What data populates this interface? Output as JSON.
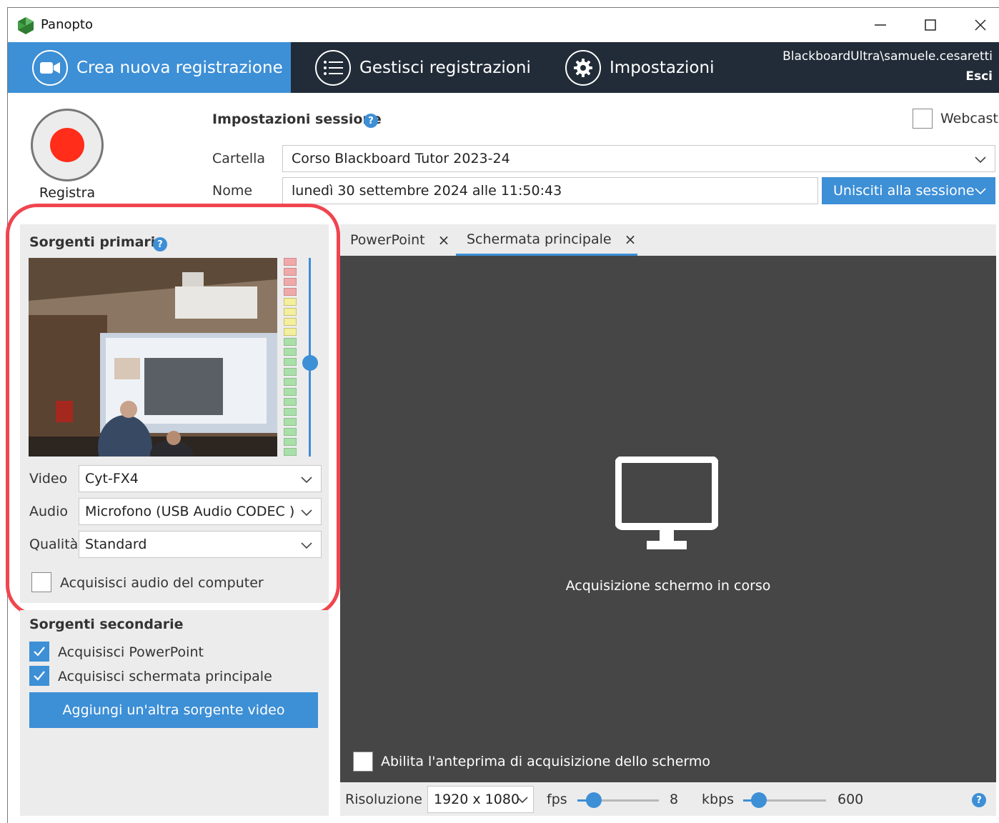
{
  "window": {
    "title": "Panopto"
  },
  "nav": {
    "tabs": [
      {
        "label": "Crea nuova registrazione",
        "icon": "video-camera-icon"
      },
      {
        "label": "Gestisci registrazioni",
        "icon": "list-icon"
      },
      {
        "label": "Impostazioni",
        "icon": "gear-icon"
      }
    ],
    "user": "BlackboardUltra\\samuele.cesaretti",
    "logout": "Esci"
  },
  "record": {
    "label": "Registra"
  },
  "session": {
    "title": "Impostazioni sessione",
    "webcast_label": "Webcast",
    "webcast_checked": false,
    "folder_label": "Cartella",
    "folder_value": "Corso Blackboard Tutor 2023-24",
    "name_label": "Nome",
    "name_value": "lunedì 30 settembre 2024 alle 11:50:43",
    "join_label": "Unisciti alla sessione"
  },
  "primary": {
    "title": "Sorgenti primarie",
    "video_label": "Video",
    "video_value": "Cyt-FX4",
    "audio_label": "Audio",
    "audio_value": "Microfono (USB Audio CODEC )",
    "quality_label": "Qualità",
    "quality_value": "Standard",
    "computer_audio_label": "Acquisisci audio del computer",
    "computer_audio_checked": false,
    "volume_level": 0.47
  },
  "secondary": {
    "title": "Sorgenti secondarie",
    "items": [
      {
        "label": "Acquisisci PowerPoint",
        "checked": true
      },
      {
        "label": "Acquisisci schermata principale",
        "checked": true
      }
    ],
    "add_label": "Aggiungi un'altra sorgente video"
  },
  "preview": {
    "tabs": [
      {
        "label": "PowerPoint",
        "active": false
      },
      {
        "label": "Schermata principale",
        "active": true
      }
    ],
    "status": "Acquisizione schermo in corso",
    "enable_preview_label": "Abilita l'anteprima di acquisizione dello schermo",
    "enable_preview_checked": false
  },
  "capture_settings": {
    "resolution_label": "Risoluzione",
    "resolution_value": "1920 x 1080",
    "fps_label": "fps",
    "fps_value": "8",
    "kbps_label": "kbps",
    "kbps_value": "600"
  },
  "colors": {
    "accent": "#3d8fd6",
    "navbar": "#222c38",
    "record": "#ff2d1a",
    "highlight": "#f0454f",
    "preview_bg": "#464646"
  }
}
